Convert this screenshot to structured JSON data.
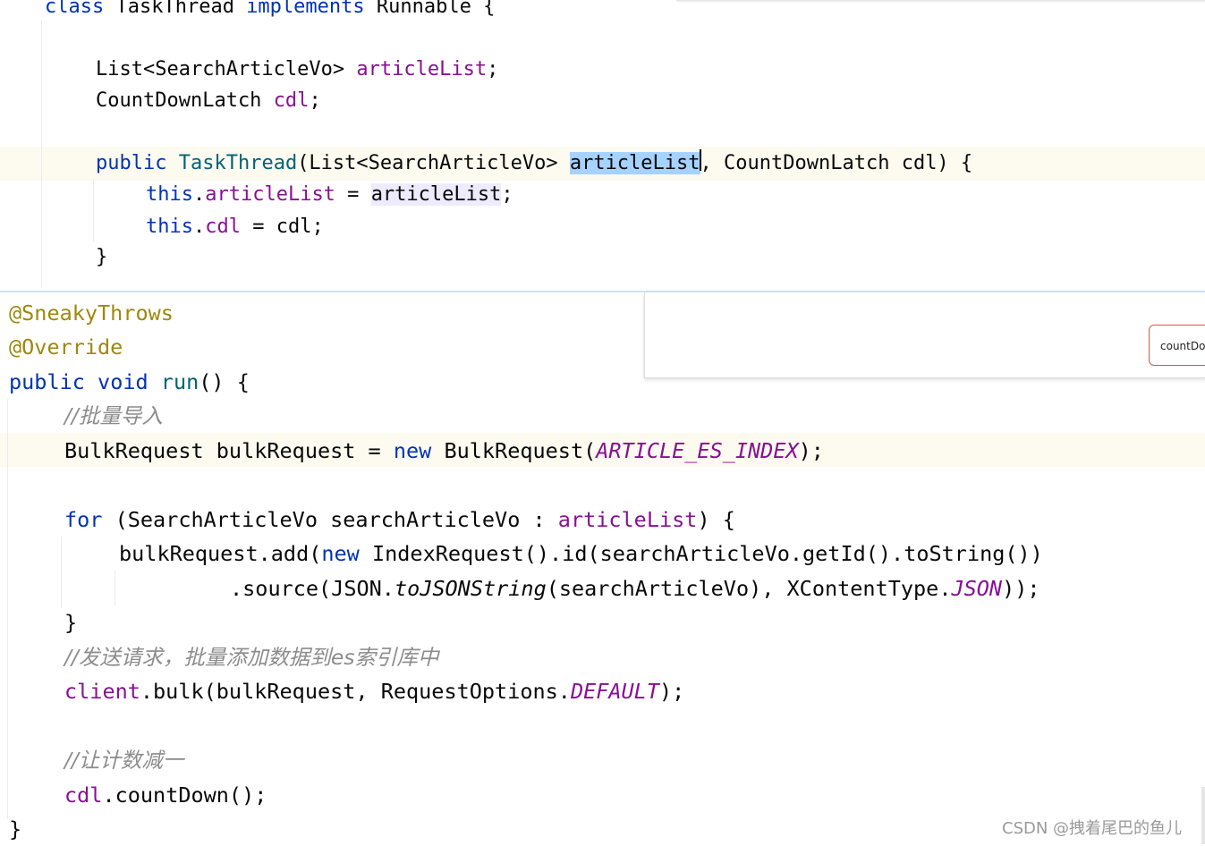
{
  "top_panel": {
    "class_decl": {
      "kw1": "class",
      "name": "TaskThread",
      "kw2": "implements",
      "iface": "Runnable",
      "brace": "{"
    },
    "field1": {
      "type": "List<SearchArticleVo>",
      "name": "articleList",
      "semi": ";"
    },
    "field2": {
      "type": "CountDownLatch",
      "name": "cdl",
      "semi": ";"
    },
    "ctor": {
      "kw": "public",
      "name": "TaskThread",
      "open": "(List<SearchArticleVo> ",
      "param1": "articleList",
      "rest": ", CountDownLatch cdl) {"
    },
    "assign1": {
      "this": "this",
      "dot": ".",
      "field": "articleList",
      "eq": " = ",
      "value": "articleList",
      "semi": ";"
    },
    "assign2": {
      "this": "this",
      "dot": ".",
      "field": "cdl",
      "eq": " = ",
      "value": "cdl",
      "semi": ";"
    },
    "close": "}"
  },
  "main": {
    "ann1": "@SneakyThrows",
    "ann2": "@Override",
    "run_sig": {
      "kw1": "public",
      "kw2": "void",
      "name": "run",
      "rest": "() {"
    },
    "comment1": "//批量导入",
    "bulk_line": {
      "type": "BulkRequest bulkRequest = ",
      "kw": "new",
      "ctor": " BulkRequest(",
      "const": "ARTICLE_ES_INDEX",
      "end": ");"
    },
    "for_line": {
      "kw": "for",
      "open": " (SearchArticleVo searchArticleVo : ",
      "field": "articleList",
      "end": ") {"
    },
    "add_line": {
      "pre": "bulkRequest.add(",
      "kw": "new",
      "rest": " IndexRequest().id(searchArticleVo.getId().toString())"
    },
    "source_line": {
      "pre": ".source(JSON.",
      "method": "toJSONString",
      "mid": "(searchArticleVo), XContentType.",
      "const": "JSON",
      "end": "));"
    },
    "for_close": "}",
    "comment2": "//发送请求，批量添加数据到es索引库中",
    "client_line": {
      "field": "client",
      "mid": ".bulk(bulkRequest, RequestOptions.",
      "const": "DEFAULT",
      "end": ");"
    },
    "comment3": "//让计数减一",
    "cdl_line": {
      "field": "cdl",
      "rest": ".countDown();"
    },
    "close": "}"
  },
  "popup": {
    "button_label": "countDo"
  },
  "watermark": "CSDN @拽着尾巴的鱼儿",
  "colors": {
    "keyword": "#0033b3",
    "field": "#871094",
    "class_name": "#00627a",
    "annotation": "#9e880d",
    "comment": "#8c8c8c",
    "selection": "#a6d2ff",
    "current_line": "#fdfaf0"
  }
}
